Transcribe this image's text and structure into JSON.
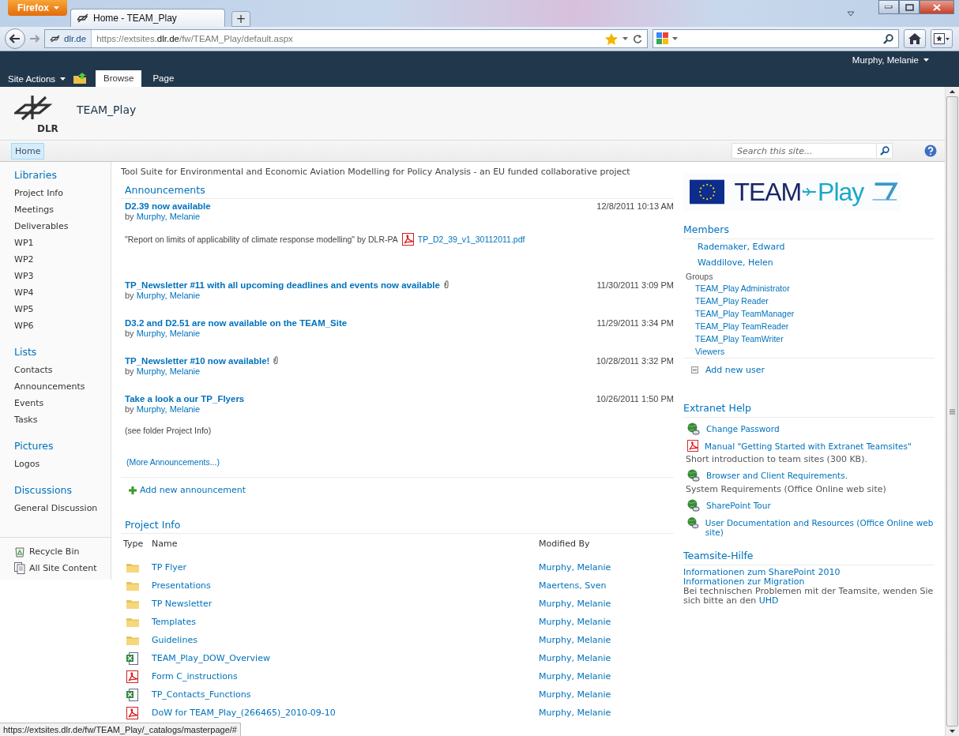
{
  "browser": {
    "app_button": "Firefox",
    "tabs": [
      {
        "title": "Home - TEAM_Play",
        "selected": true
      }
    ],
    "new_tab": "+",
    "identity": "dlr.de",
    "url": "https://extsites.**dlr.de**/fw/TEAM_Play/default.aspx"
  },
  "ribbon": {
    "site_actions": "Site Actions",
    "user": "Murphy, Melanie",
    "tabs": [
      {
        "label": "Browse",
        "selected": true
      },
      {
        "label": "Page",
        "selected": false
      }
    ]
  },
  "site": {
    "logo_text": "DLR",
    "title": "TEAM_Play"
  },
  "top_nav": {
    "items": [
      {
        "label": "Home",
        "selected": true
      }
    ],
    "search": {
      "placeholder": "Search this site..."
    }
  },
  "left_nav": {
    "sections": [
      {
        "heading": "Libraries",
        "items": [
          "Project Info",
          "Meetings",
          "Deliverables",
          "WP1",
          "WP2",
          "WP3",
          "WP4",
          "WP5",
          "WP6"
        ]
      },
      {
        "heading": "Lists",
        "items": [
          "Contacts",
          "Announcements",
          "Events",
          "Tasks"
        ]
      },
      {
        "heading": "Pictures",
        "items": [
          "Logos"
        ]
      },
      {
        "heading": "Discussions",
        "items": [
          "General Discussion"
        ]
      }
    ],
    "footer": [
      {
        "kind": "recycle",
        "label": "Recycle Bin"
      },
      {
        "kind": "content",
        "label": "All Site Content"
      }
    ]
  },
  "description": "Tool Suite for Environmental and Economic Aviation Modelling for Policy Analysis - an EU funded collaborative project",
  "announcements": {
    "heading": "Announcements",
    "items": [
      {
        "title": "D2.39 now available",
        "by": "by",
        "author": "Murphy, Melanie",
        "date": "12/8/2011 10:13 AM",
        "attachment": false,
        "body": "\"Report on limits of applicability of climate response modelling\" by DLR-PA",
        "file": "TP_D2_39_v1_30112011.pdf"
      },
      {
        "title": "TP_Newsletter #11 with all upcoming deadlines and events now available",
        "by": "by",
        "author": "Murphy, Melanie",
        "date": "11/30/2011 3:09 PM",
        "attachment": true
      },
      {
        "title": "D3.2 and D2.51 are now available on the TEAM_Site",
        "by": "by",
        "author": "Murphy, Melanie",
        "date": "11/29/2011 3:34 PM",
        "attachment": false
      },
      {
        "title": "TP_Newsletter #10 now available!",
        "by": "by",
        "author": "Murphy, Melanie",
        "date": "10/28/2011 3:32 PM",
        "attachment": true
      },
      {
        "title": "Take a look a our TP_Flyers",
        "by": "by",
        "author": "Murphy, Melanie",
        "date": "10/26/2011 1:50 PM",
        "attachment": false,
        "body": "(see folder Project Info)"
      }
    ],
    "more": "(More Announcements...)",
    "add": "Add new announcement"
  },
  "project_info": {
    "heading": "Project Info",
    "columns": [
      "Type",
      "Name",
      "Modified By"
    ],
    "rows": [
      {
        "kind": "folder",
        "name": "TP Flyer",
        "modified_by": "Murphy, Melanie"
      },
      {
        "kind": "folder",
        "name": "Presentations",
        "modified_by": "Maertens, Sven"
      },
      {
        "kind": "folder",
        "name": "TP Newsletter",
        "modified_by": "Murphy, Melanie"
      },
      {
        "kind": "folder",
        "name": "Templates",
        "modified_by": "Murphy, Melanie"
      },
      {
        "kind": "folder",
        "name": "Guidelines",
        "modified_by": "Murphy, Melanie"
      },
      {
        "kind": "sheet",
        "name": "TEAM_Play_DOW_Overview",
        "modified_by": "Murphy, Melanie"
      },
      {
        "kind": "pdf",
        "name": "Form C_instructions",
        "modified_by": "Murphy, Melanie"
      },
      {
        "kind": "sheet",
        "name": "TP_Contacts_Functions",
        "modified_by": "Murphy, Melanie"
      },
      {
        "kind": "pdf",
        "name": "DoW for TEAM_Play_(266465)_2010-09-10",
        "modified_by": "Murphy, Melanie"
      }
    ]
  },
  "project_logo": {
    "word1": "TEAM",
    "word2": "Play"
  },
  "members": {
    "heading": "Members",
    "people": [
      "Rademaker, Edward",
      "Waddilove, Helen"
    ],
    "groups_label": "Groups",
    "groups": [
      "TEAM_Play Administrator",
      "TEAM_Play Reader",
      "TEAM_Play TeamManager",
      "TEAM_Play TeamReader",
      "TEAM_Play TeamWriter",
      "Viewers"
    ],
    "add": "Add new user"
  },
  "extranet_help": {
    "heading": "Extranet Help",
    "items": [
      {
        "kind": "link",
        "label": "Change Password"
      },
      {
        "kind": "pdf",
        "label": "Manual \"Getting Started with Extranet Teamsites\"",
        "description": "Short introduction to team sites (300 KB)."
      },
      {
        "kind": "link",
        "label": "Browser and Client Requirements.",
        "description": "System Requirements (Office Online web site)"
      },
      {
        "kind": "link",
        "label": "SharePoint Tour"
      },
      {
        "kind": "link",
        "label": "User Documentation and Resources (Office Online web site)"
      }
    ]
  },
  "teamsite_help": {
    "heading": "Teamsite-Hilfe",
    "links": [
      "Informationen zum SharePoint 2010",
      "Informationen zur Migration"
    ],
    "text": "Bei technischen Problemen mit der Teamsite, wenden Sie sich bitte an den",
    "link": "UHD"
  },
  "status_bar": {
    "url": "https://extsites.dlr.de/fw/TEAM_Play/_catalogs/masterpage/#"
  }
}
